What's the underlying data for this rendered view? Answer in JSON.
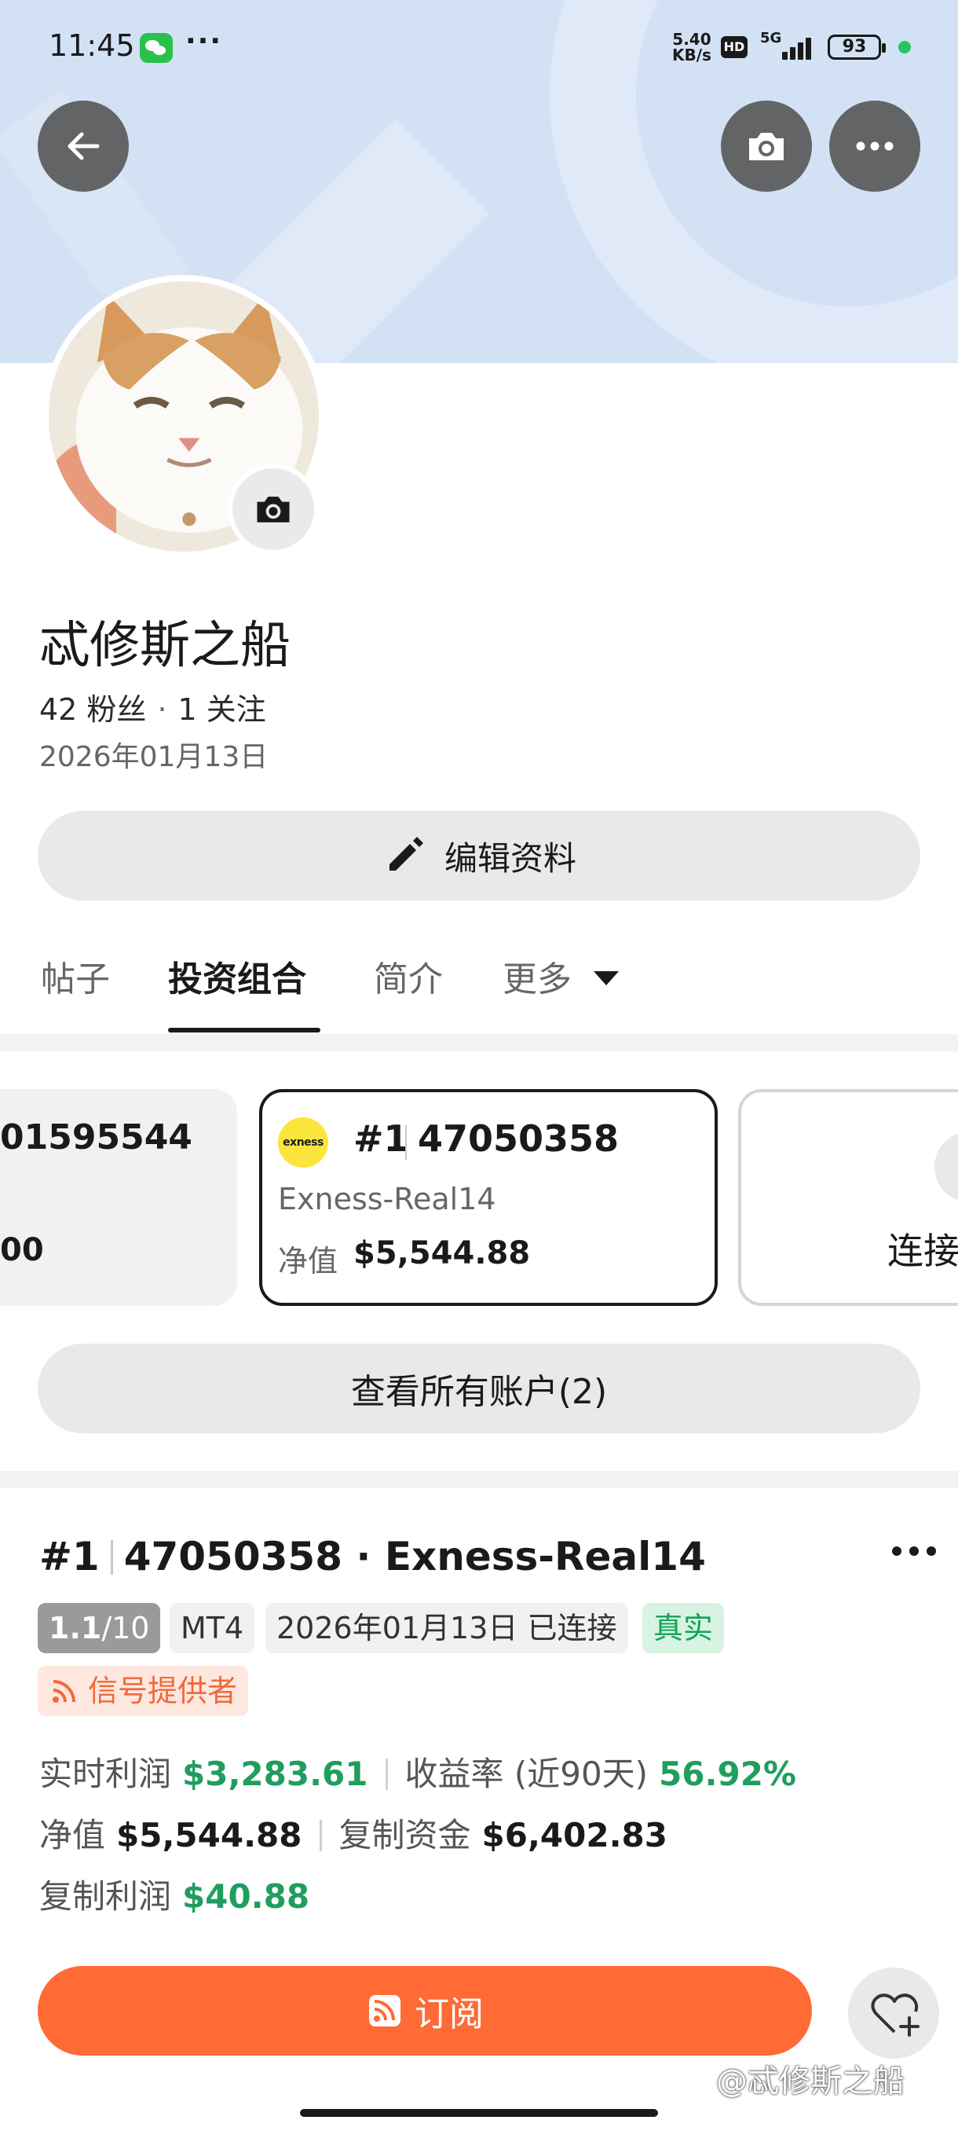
{
  "status_bar": {
    "time": "11:45",
    "more": "···",
    "speed_value": "5.40",
    "speed_unit": "KB/s",
    "hd": "HD",
    "network": "5G",
    "battery": "93"
  },
  "header": {
    "back_icon": "arrow-left-icon",
    "camera_icon": "camera-icon",
    "more_icon": "more-horizontal-icon"
  },
  "profile": {
    "name": "忒修斯之船",
    "followers": "42 粉丝",
    "following": "1 关注",
    "joined": "2026年01月13日",
    "edit_label": "编辑资料"
  },
  "tabs": {
    "posts": "帖子",
    "portfolio": "投资组合",
    "intro": "简介",
    "more": "更多",
    "active": "投资组合"
  },
  "accounts": {
    "left_number": "01595544",
    "left_equity": "00",
    "current": {
      "broker_logo": "exness",
      "rank": "#1",
      "number": "47050358",
      "server": "Exness-Real14",
      "equity_label": "净值",
      "equity_value": "$5,544.88"
    },
    "connect_label": "连接",
    "view_all_label": "查看所有账户(2)"
  },
  "detail": {
    "rank": "#1",
    "title_rest": "47050358 · Exness-Real14",
    "rating_main": "1.1",
    "rating_total": "/10",
    "platform": "MT4",
    "connected": "2026年01月13日 已连接",
    "real_tag": "真实",
    "provider_tag": "信号提供者",
    "realtime_profit_label": "实时利润",
    "realtime_profit_value": "$3,283.61",
    "yield_label": "收益率 (近90天)",
    "yield_value": "56.92%",
    "equity_label": "净值",
    "equity_value": "$5,544.88",
    "copy_funds_label": "复制资金",
    "copy_funds_value": "$6,402.83",
    "copy_profit_label": "复制利润",
    "copy_profit_value": "$40.88"
  },
  "actions": {
    "subscribe_label": "订阅",
    "favorite_icon": "heart-plus-icon"
  },
  "watermark": "@忒修斯之船",
  "colors": {
    "accent_orange": "#ff6a35",
    "profit_green": "#1f9e5e",
    "banner_blue": "#d3e1f5"
  }
}
